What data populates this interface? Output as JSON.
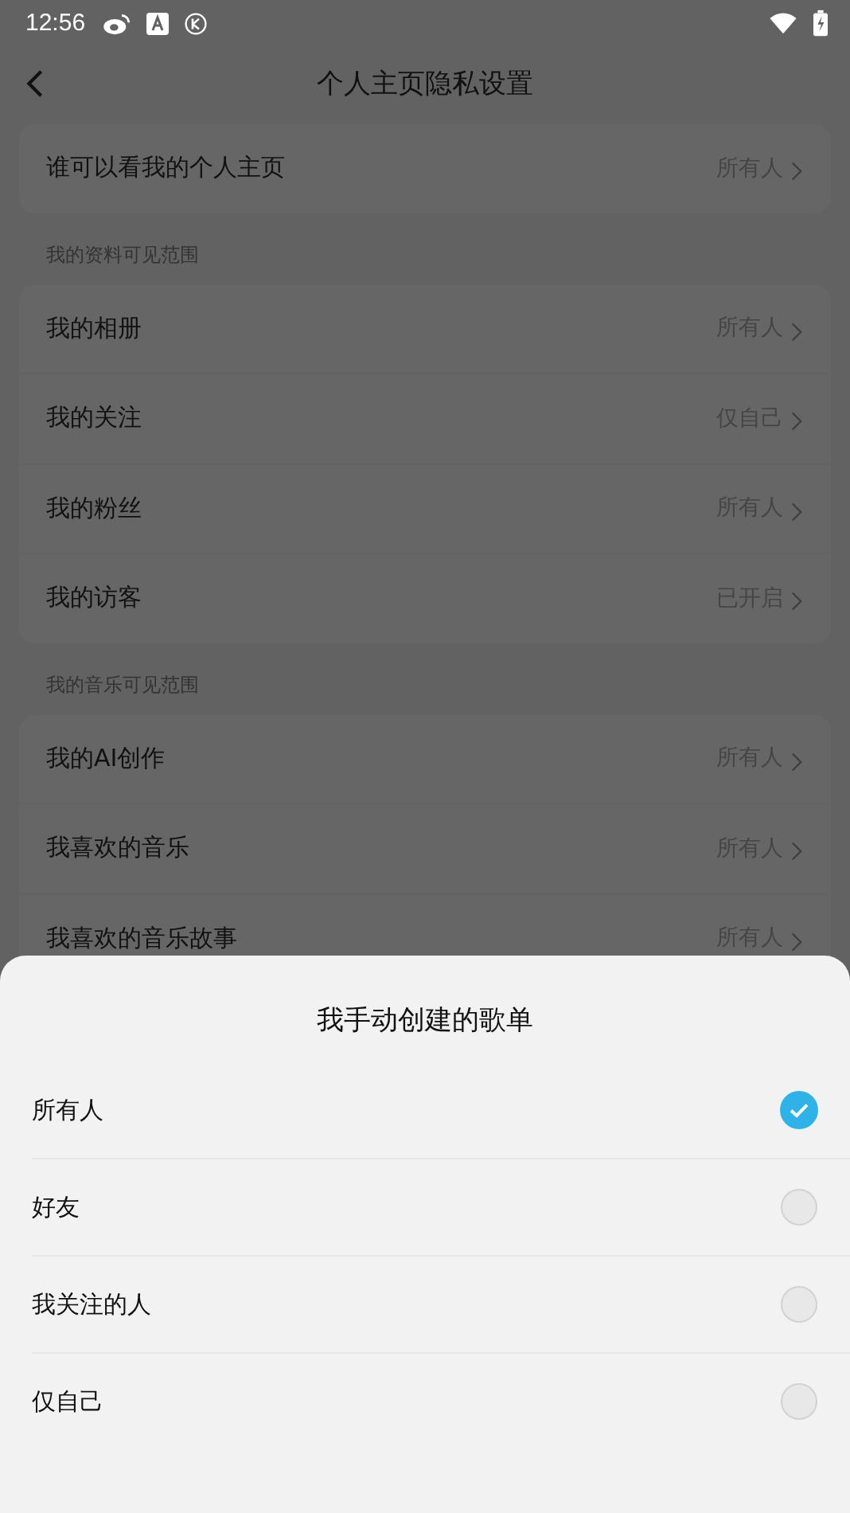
{
  "status_bar": {
    "time": "12:56"
  },
  "header": {
    "title": "个人主页隐私设置"
  },
  "sections": [
    {
      "rows": [
        {
          "label": "谁可以看我的个人主页",
          "value": "所有人"
        }
      ]
    },
    {
      "heading": "我的资料可见范围",
      "rows": [
        {
          "label": "我的相册",
          "value": "所有人"
        },
        {
          "label": "我的关注",
          "value": "仅自己"
        },
        {
          "label": "我的粉丝",
          "value": "所有人"
        },
        {
          "label": "我的访客",
          "value": "已开启"
        }
      ]
    },
    {
      "heading": "我的音乐可见范围",
      "rows": [
        {
          "label": "我的AI创作",
          "value": "所有人"
        },
        {
          "label": "我喜欢的音乐",
          "value": "所有人"
        },
        {
          "label": "我喜欢的音乐故事",
          "value": "所有人"
        }
      ]
    }
  ],
  "sheet": {
    "title": "我手动创建的歌单",
    "options": [
      {
        "label": "所有人",
        "selected": true
      },
      {
        "label": "好友",
        "selected": false
      },
      {
        "label": "我关注的人",
        "selected": false
      },
      {
        "label": "仅自己",
        "selected": false
      }
    ]
  }
}
